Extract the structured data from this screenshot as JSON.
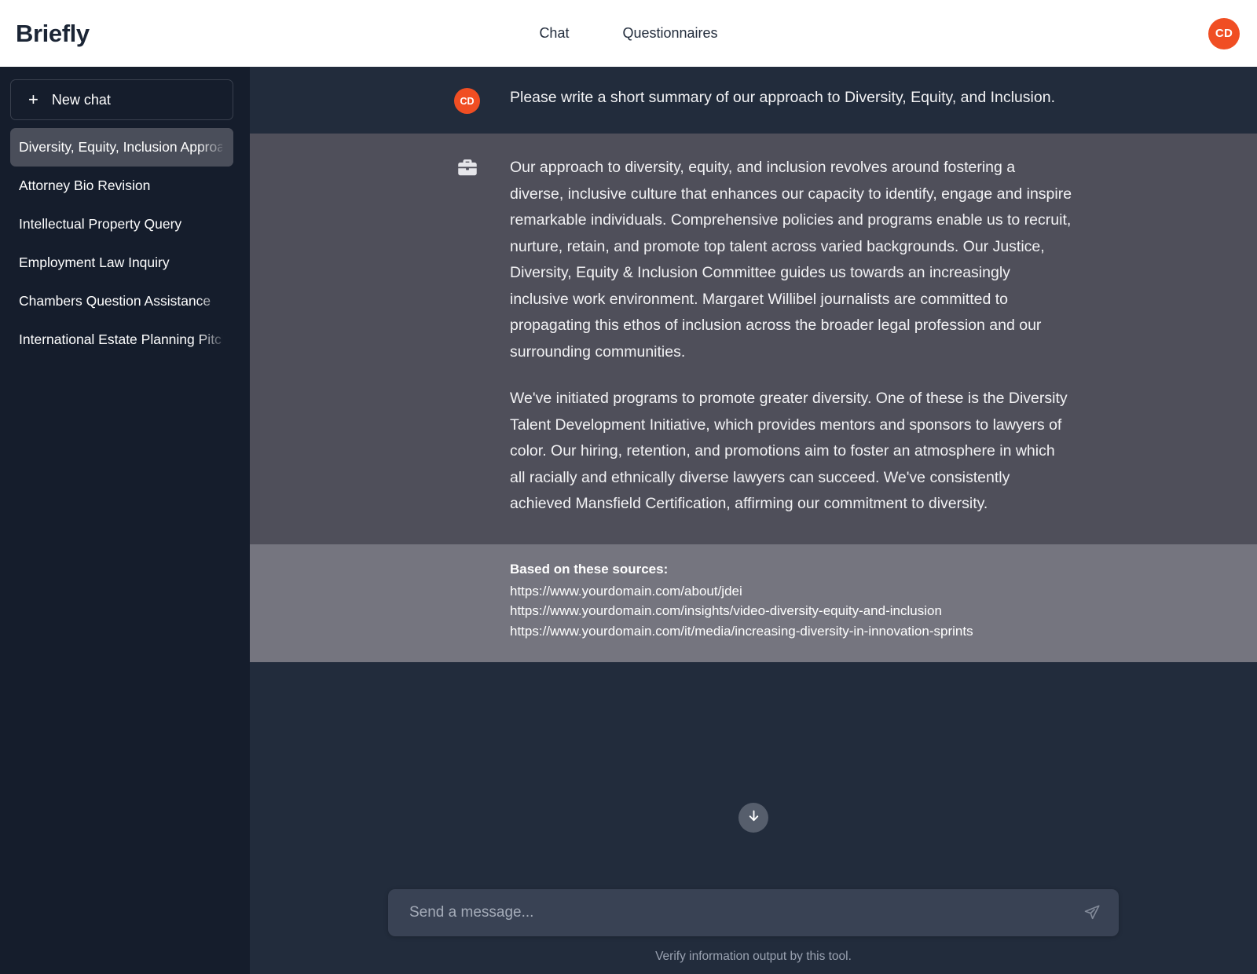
{
  "header": {
    "brand": "Briefly",
    "nav": [
      {
        "label": "Chat",
        "active": true
      },
      {
        "label": "Questionnaires",
        "active": false
      }
    ],
    "avatar_initials": "CD",
    "avatar_color": "#f04e23"
  },
  "sidebar": {
    "new_chat_label": "New chat",
    "new_chat_icon": "plus-icon",
    "chats": [
      {
        "title": "Diversity, Equity, Inclusion Approach",
        "active": true
      },
      {
        "title": "Attorney Bio Revision",
        "active": false
      },
      {
        "title": "Intellectual Property Query",
        "active": false
      },
      {
        "title": "Employment Law Inquiry",
        "active": false
      },
      {
        "title": "Chambers Question Assistance",
        "active": false
      },
      {
        "title": "International Estate Planning Pitch",
        "active": false
      }
    ]
  },
  "conversation": {
    "user_message": {
      "avatar_initials": "CD",
      "text": "Please write a short summary of our approach to Diversity, Equity, and Inclusion."
    },
    "assistant_message": {
      "icon": "briefcase-icon",
      "paragraphs": [
        "Our approach to diversity, equity, and inclusion revolves around fostering a diverse, inclusive culture that enhances our capacity to identify, engage and inspire remarkable individuals. Comprehensive policies and programs enable us to recruit, nurture, retain, and promote top talent across varied backgrounds. Our Justice, Diversity, Equity & Inclusion Committee guides us towards an increasingly inclusive work environment. Margaret Willibel journalists are committed to propagating this ethos of inclusion across the broader legal profession and our surrounding communities.",
        "We've initiated programs to promote greater diversity. One of these is the Diversity Talent Development Initiative, which provides mentors and sponsors to lawyers of color. Our hiring, retention, and promotions aim to foster an atmosphere in which all racially and ethnically diverse lawyers can succeed. We've consistently achieved Mansfield Certification, affirming our commitment to diversity."
      ]
    },
    "sources": {
      "title": "Based on these sources:",
      "links": [
        "https://www.yourdomain.com/about/jdei",
        "https://www.yourdomain.com/insights/video-diversity-equity-and-inclusion",
        "https://www.yourdomain.com/it/media/increasing-diversity-in-innovation-sprints"
      ]
    }
  },
  "composer": {
    "placeholder": "Send a message...",
    "value": "",
    "send_icon": "send-paper-plane-icon",
    "scroll_down_icon": "arrow-down-icon",
    "disclaimer": "Verify information output by this tool."
  }
}
